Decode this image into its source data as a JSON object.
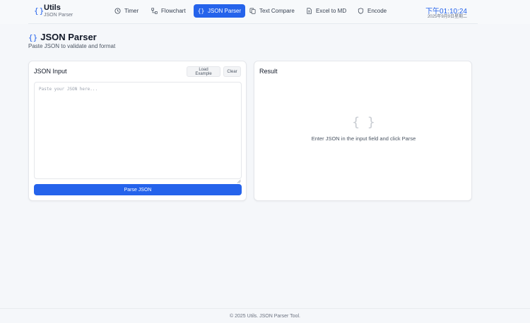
{
  "header": {
    "brand_icon": "{}",
    "brand_title": "Utils",
    "brand_subtitle": "JSON Parser",
    "clock_time": "下午01:10:24",
    "clock_date": "2025年9月9日星期二"
  },
  "nav": [
    {
      "label": "Timer",
      "icon": "clock-icon",
      "active": false
    },
    {
      "label": "Flowchart",
      "icon": "flowchart-icon",
      "active": false
    },
    {
      "label": "JSON Parser",
      "icon": "braces-icon",
      "active": true
    },
    {
      "label": "Text Compare",
      "icon": "copy-icon",
      "active": false
    },
    {
      "label": "Excel to MD",
      "icon": "file-icon",
      "active": false
    },
    {
      "label": "Encode",
      "icon": "shield-icon",
      "active": false
    }
  ],
  "page": {
    "title_icon": "{}",
    "title": "JSON Parser",
    "subtitle": "Paste JSON to validate and format"
  },
  "input_card": {
    "title": "JSON Input",
    "load_example_label": "Load Example",
    "clear_label": "Clear",
    "placeholder": "Paste your JSON here...",
    "value": "",
    "parse_label": "Parse JSON"
  },
  "result_card": {
    "title": "Result",
    "empty_icon": "{ }",
    "empty_text": "Enter JSON in the input field and click Parse"
  },
  "footer": {
    "text": "© 2025 Utils. JSON Parser Tool."
  },
  "colors": {
    "accent": "#2563eb",
    "background": "#f5f7fa",
    "card": "#ffffff"
  }
}
